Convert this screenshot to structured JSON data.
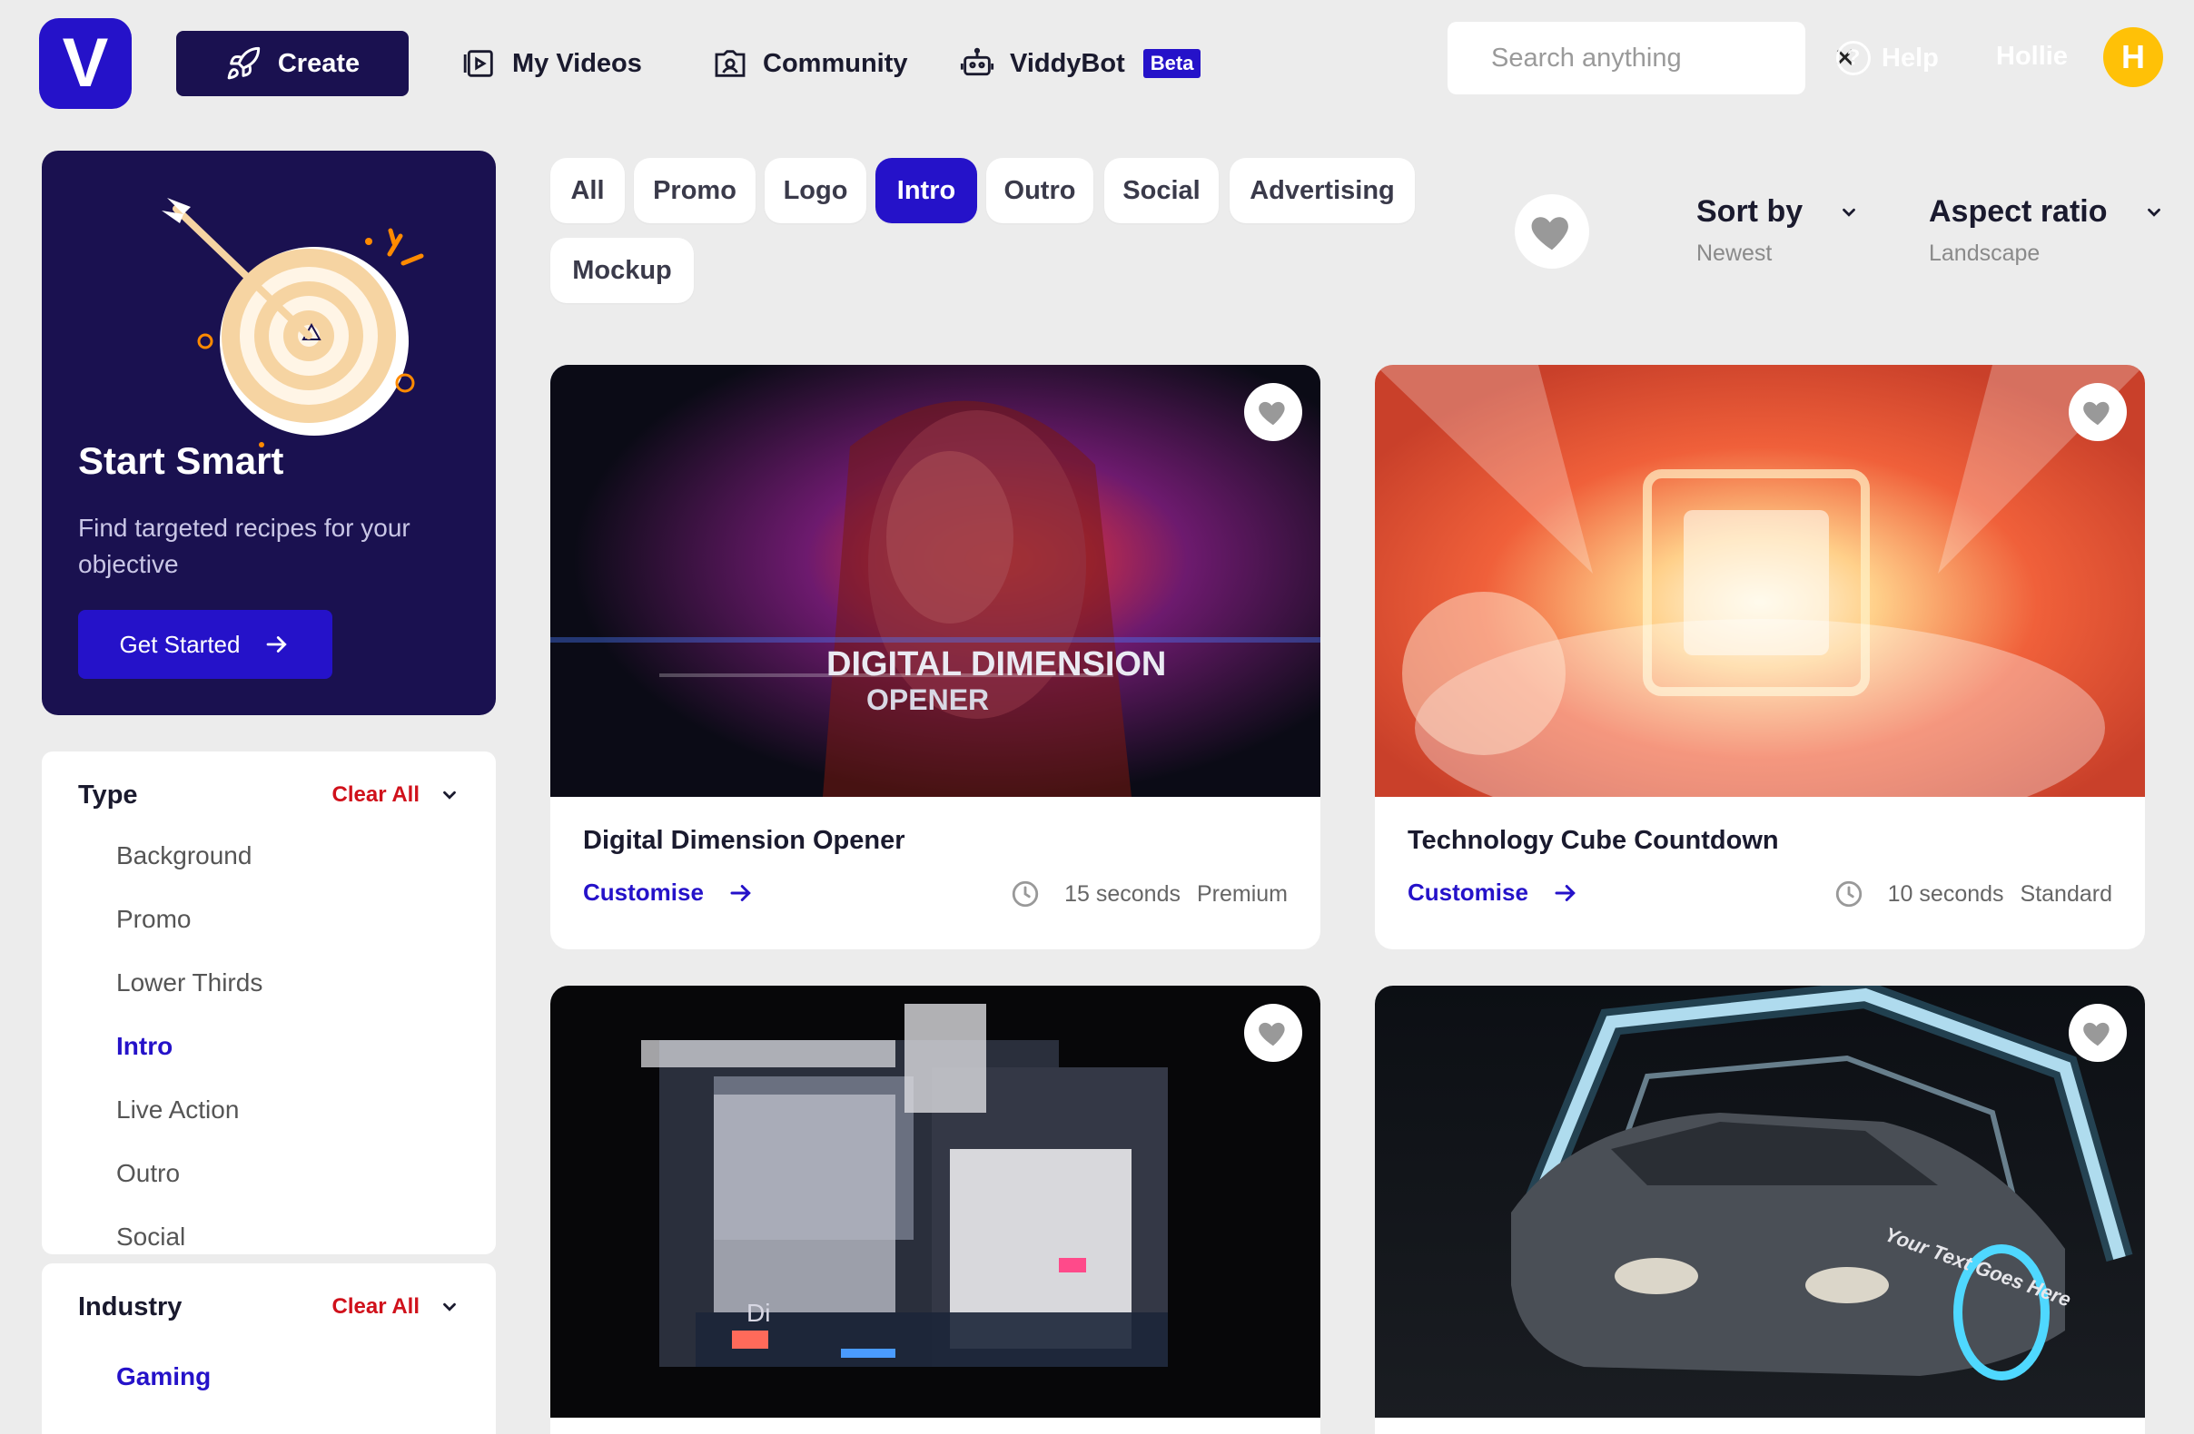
{
  "header": {
    "logo_letter": "V",
    "create_label": "Create",
    "nav": [
      {
        "label": "My Videos",
        "icon": "video-library-icon"
      },
      {
        "label": "Community",
        "icon": "community-icon"
      },
      {
        "label": "ViddyBot",
        "icon": "robot-icon",
        "badge": "Beta"
      }
    ],
    "search": {
      "placeholder": "Search anything",
      "value": ""
    },
    "help_label": "Help",
    "user_name": "Hollie",
    "avatar_initial": "H"
  },
  "sidebar": {
    "promo": {
      "title": "Start Smart",
      "description": "Find targeted recipes for your objective",
      "cta": "Get Started"
    },
    "filters": [
      {
        "title": "Type",
        "clear_label": "Clear All",
        "options": [
          {
            "label": "Background",
            "active": false
          },
          {
            "label": "Promo",
            "active": false
          },
          {
            "label": "Lower Thirds",
            "active": false
          },
          {
            "label": "Intro",
            "active": true
          },
          {
            "label": "Live Action",
            "active": false
          },
          {
            "label": "Outro",
            "active": false
          },
          {
            "label": "Social",
            "active": false
          }
        ]
      },
      {
        "title": "Industry",
        "clear_label": "Clear All",
        "options": [
          {
            "label": "Gaming",
            "active": true
          }
        ]
      }
    ]
  },
  "categories": [
    {
      "label": "All",
      "active": false
    },
    {
      "label": "Promo",
      "active": false
    },
    {
      "label": "Logo",
      "active": false
    },
    {
      "label": "Intro",
      "active": true
    },
    {
      "label": "Outro",
      "active": false
    },
    {
      "label": "Social",
      "active": false
    },
    {
      "label": "Advertising",
      "active": false
    },
    {
      "label": "Mockup",
      "active": false
    }
  ],
  "sort": {
    "label": "Sort by",
    "value": "Newest"
  },
  "aspect": {
    "label": "Aspect ratio",
    "value": "Landscape"
  },
  "cards": [
    {
      "title": "Digital Dimension Opener",
      "customise_label": "Customise",
      "duration": "15 seconds",
      "tier": "Premium",
      "thumb_text": "DIGITAL DIMENSION",
      "thumb_subtext": "OPENER"
    },
    {
      "title": "Technology Cube Countdown",
      "customise_label": "Customise",
      "duration": "10 seconds",
      "tier": "Standard"
    },
    {
      "thumb_text": "Di"
    },
    {
      "thumb_text": "Your Text Goes Here"
    }
  ],
  "colors": {
    "brand": "#2512c9",
    "dark_navy": "#1a1150",
    "danger": "#d0111b",
    "avatar": "#ffc107"
  }
}
